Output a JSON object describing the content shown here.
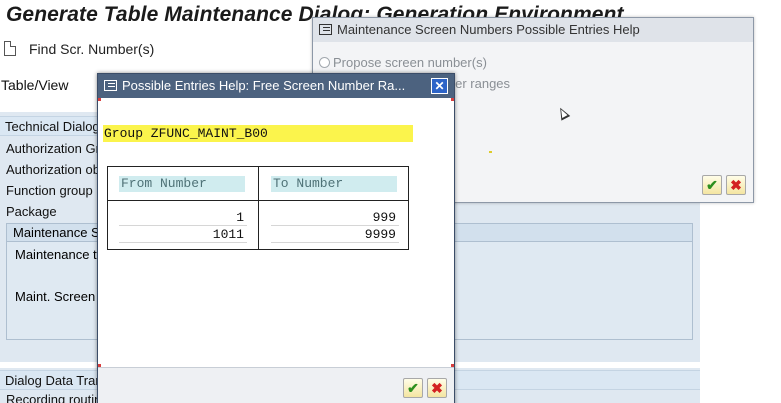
{
  "background": {
    "title": "Generate Table Maintenance Dialog: Generation Environment",
    "toolbar": {
      "find_label": "Find Scr. Number(s)"
    },
    "table_view_label": "Table/View",
    "sections": {
      "technical_dialog": "Technical Dialog Details",
      "authorization_group": "Authorization Group",
      "authorization_object": "Authorization object",
      "function_group": "Function group",
      "package": "Package",
      "maintenance_screens_header": "Maintenance Screens",
      "maintenance_type": "Maintenance type",
      "maint_screen_no": "Maint. Screen No.",
      "dialog_data_transport": "Dialog Data Transport Details",
      "recording_routine": "Recording routine"
    }
  },
  "screen_numbers_dialog": {
    "title": "Maintenance Screen Numbers Possible Entries Help",
    "options": [
      "Propose screen number(s)",
      "Search for free number ranges"
    ]
  },
  "free_ranges_dialog": {
    "title": "Possible Entries Help: Free Screen Number Ra...",
    "group_label": "Group ZFUNC_MAINT_B00",
    "columns": [
      "From Number",
      "To Number"
    ],
    "rows": [
      {
        "from": "1",
        "to": "999"
      },
      {
        "from": "1011",
        "to": "9999"
      }
    ]
  },
  "colors": {
    "dialog_title_active": "#4c627f",
    "highlight_field": "#fbf44c",
    "column_header": "#d0ecef",
    "ok_green": "#2d8f1e",
    "cancel_red": "#d32222"
  },
  "icons": {
    "ok": "check-icon",
    "cancel": "cancel-icon",
    "close": "close-icon",
    "dialog": "dialog-window-icon",
    "document": "document-icon"
  }
}
